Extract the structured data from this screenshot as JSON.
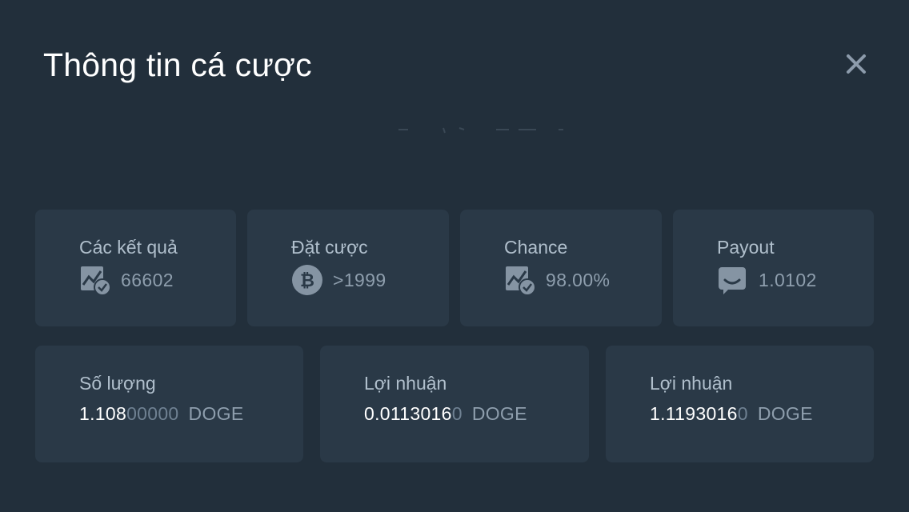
{
  "modal": {
    "title": "Thông tin cá cược",
    "close_icon": "close-icon"
  },
  "stats": [
    {
      "label": "Các kết quả",
      "icon": "chart-check-icon",
      "value": "66602"
    },
    {
      "label": "Đặt cược",
      "icon": "bitcoin-icon",
      "value": ">1999"
    },
    {
      "label": "Chance",
      "icon": "chart-check-icon",
      "value": "98.00%"
    },
    {
      "label": "Payout",
      "icon": "smile-chat-icon",
      "value": "1.0102"
    }
  ],
  "amounts": [
    {
      "label": "Số lượng",
      "main": "1.108",
      "dim": "00000",
      "unit": "DOGE"
    },
    {
      "label": "Lợi nhuận",
      "main": "0.0113016",
      "dim": "0",
      "unit": "DOGE"
    },
    {
      "label": "Lợi nhuận",
      "main": "1.1193016",
      "dim": "0",
      "unit": "DOGE"
    }
  ],
  "colors": {
    "background": "#222f3b",
    "card": "#2a3947",
    "title": "#ffffff",
    "label": "#b0bfcc",
    "value": "#8e9ead",
    "icon": "#8594a3"
  }
}
